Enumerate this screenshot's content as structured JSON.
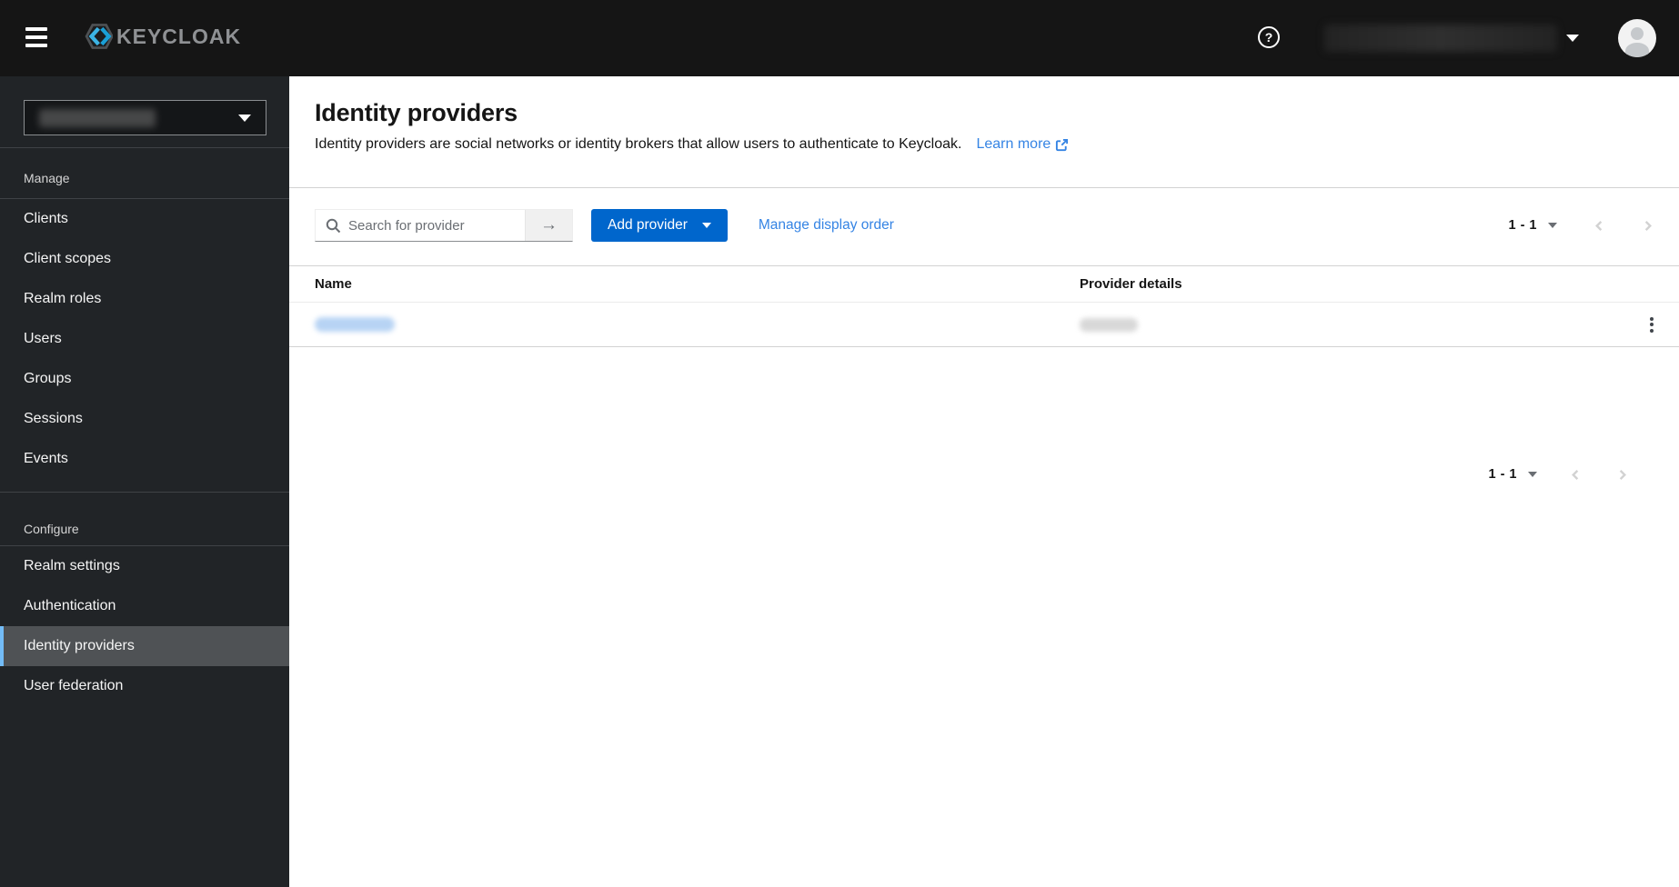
{
  "brand": {
    "name": "KEYCLOAK"
  },
  "icons": {
    "help": "?",
    "search_submit": "→"
  },
  "topnav": {
    "username_redacted": true
  },
  "sidebar": {
    "realm_selector": {
      "value_redacted": true
    },
    "sections": [
      {
        "label": "Manage",
        "items": [
          {
            "label": "Clients"
          },
          {
            "label": "Client scopes"
          },
          {
            "label": "Realm roles"
          },
          {
            "label": "Users"
          },
          {
            "label": "Groups"
          },
          {
            "label": "Sessions"
          },
          {
            "label": "Events"
          }
        ]
      },
      {
        "label": "Configure",
        "items": [
          {
            "label": "Realm settings"
          },
          {
            "label": "Authentication"
          },
          {
            "label": "Identity providers",
            "selected": true
          },
          {
            "label": "User federation"
          }
        ]
      }
    ]
  },
  "page": {
    "title": "Identity providers",
    "description": "Identity providers are social networks or identity brokers that allow users to authenticate to Keycloak.",
    "learn_more_label": "Learn more"
  },
  "toolbar": {
    "search": {
      "placeholder": "Search for provider"
    },
    "add_provider_label": "Add provider",
    "manage_display_order_label": "Manage display order"
  },
  "pagination": {
    "range": "1 - 1"
  },
  "table": {
    "columns": {
      "name": "Name",
      "provider_details": "Provider details"
    },
    "rows": [
      {
        "name_redacted": true,
        "details_redacted": true
      }
    ]
  },
  "colors": {
    "topnav_bg": "#151515",
    "sidebar_bg": "#212427",
    "selected_item_bg": "#4f5255",
    "selected_item_accent": "#73bcf7",
    "primary_button": "#0066cc",
    "link": "#3584e4"
  }
}
